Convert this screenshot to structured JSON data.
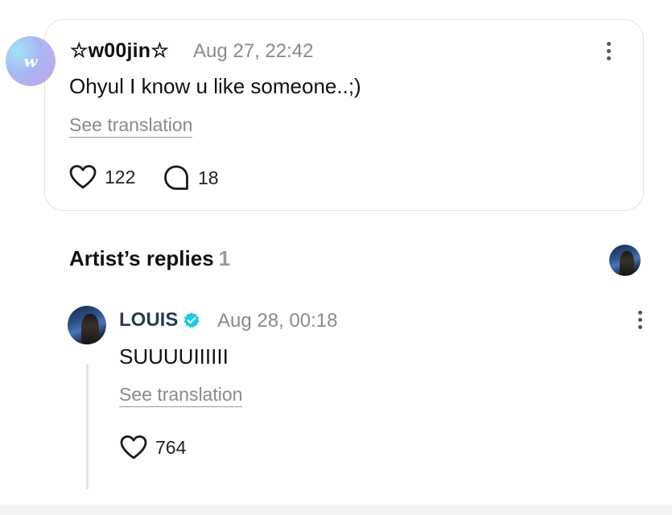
{
  "comment": {
    "username": "☆w00jin☆",
    "timestamp": "Aug 27, 22:42",
    "text": "Ohyul I know u like someone..;)",
    "translate_label": "See translation",
    "likes": "122",
    "replies": "18",
    "avatar_letter": "w"
  },
  "artist_replies": {
    "title": "Artist’s replies",
    "count": "1"
  },
  "reply": {
    "username": "LOUIS",
    "timestamp": "Aug 28, 00:18",
    "text": "SUUUUIIIIII",
    "translate_label": "See translation",
    "likes": "764"
  },
  "colors": {
    "verified": "#1ec8e6",
    "muted": "#8a8a8a"
  }
}
